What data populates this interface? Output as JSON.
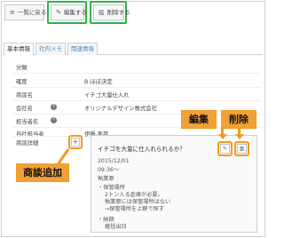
{
  "toolbar": {
    "back_label": "一覧に戻る",
    "edit_label": "編集する",
    "delete_label": "削除する"
  },
  "tabs": [
    "基本情報",
    "社内メモ",
    "関連情報"
  ],
  "fields": [
    {
      "label": "分類",
      "value": ""
    },
    {
      "label": "確度",
      "value": "B:ほぼ決定"
    },
    {
      "label": "商談名",
      "value": "イチゴ大量仕入れ"
    },
    {
      "label": "会社名",
      "value": "オリジナルデザイン株式会社"
    },
    {
      "label": "担当者名",
      "value": ""
    },
    {
      "label": "自社担当者",
      "value": "伊藤 美菜"
    },
    {
      "label": "商談詳細",
      "value": ""
    }
  ],
  "comment": {
    "title": "イチゴを大量に仕入れられるか？",
    "lines": [
      "2015/12/01",
      "09:36～",
      "執業原",
      "・保管場所",
      "2トン入る倉庫が必要。",
      "執業原には保管場所はない",
      "→保管場所を上野で探す",
      "・納期",
      "継括出日"
    ]
  },
  "callouts": {
    "edit": "編集",
    "delete": "削除",
    "add": "商談追加"
  },
  "icons": {
    "back": "list-icon",
    "edit": "pencil-icon",
    "delete": "trash-icon",
    "add": "plus-icon",
    "help": "question-icon"
  },
  "colors": {
    "highlight_green": "#2fb24a",
    "callout_orange": "#f39a20",
    "tab_link": "#4a8ac8"
  }
}
